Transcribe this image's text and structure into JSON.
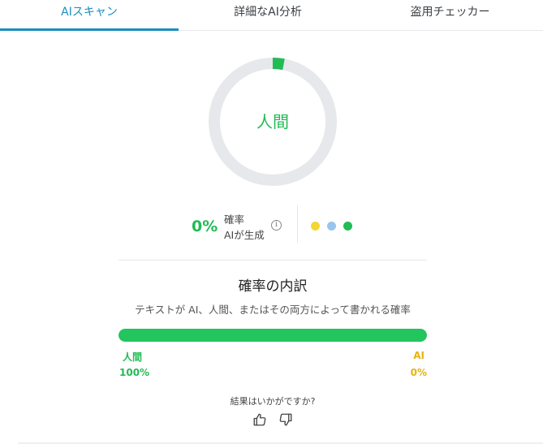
{
  "tabs": [
    {
      "label": "AIスキャン",
      "active": true
    },
    {
      "label": "詳細なAI分析",
      "active": false
    },
    {
      "label": "盗用チェッカー",
      "active": false
    }
  ],
  "result": {
    "label": "人間",
    "ai_fraction": 0.03
  },
  "stats": {
    "percent": "0%",
    "desc_line1": "確率",
    "desc_line2": "AIが生成",
    "info_icon": "info-icon"
  },
  "legend_dots": [
    {
      "color": "#f5d535",
      "icon": "dot-yellow"
    },
    {
      "color": "#98c4ee",
      "icon": "dot-blue"
    },
    {
      "color": "#22bb55",
      "icon": "dot-green"
    }
  ],
  "breakdown": {
    "title": "確率の内訳",
    "subtitle": "テキストが AI、人間、またはその両方によって書かれる確率",
    "human_fraction": 1.0,
    "human_label": "人間",
    "human_value": "100%",
    "ai_label": "AI",
    "ai_value": "0%"
  },
  "feedback": {
    "question": "結果はいかがですか?",
    "up_icon": "thumbs-up-icon",
    "down_icon": "thumbs-down-icon"
  },
  "colors": {
    "accent": "#1b8ec0",
    "human": "#22bb55",
    "ai": "#e8b20e",
    "track": "#e6e8eb"
  }
}
